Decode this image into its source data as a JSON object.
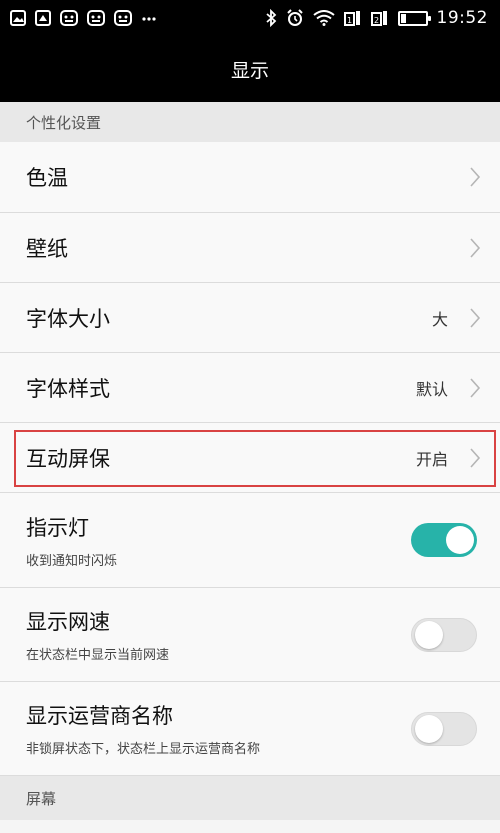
{
  "status_bar": {
    "time": "19:52",
    "battery_level": 0.22,
    "left_icons": [
      "image-icon",
      "gallery-icon",
      "message-icon",
      "message-icon",
      "message-icon",
      "more-dots-icon"
    ],
    "right_icons": [
      "bluetooth-icon",
      "alarm-icon",
      "wifi-icon",
      "sim1-signal-icon",
      "sim2-signal-icon",
      "battery-icon"
    ]
  },
  "app_bar": {
    "title": "显示"
  },
  "sections": {
    "personalization": "个性化设置",
    "screen": "屏幕"
  },
  "rows": {
    "color_temp": {
      "label": "色温"
    },
    "wallpaper": {
      "label": "壁纸"
    },
    "font_size": {
      "label": "字体大小",
      "value": "大"
    },
    "font_style": {
      "label": "字体样式",
      "value": "默认"
    },
    "screensaver": {
      "label": "互动屏保",
      "value": "开启"
    },
    "indicator": {
      "label": "指示灯",
      "sub": "收到通知时闪烁",
      "enabled": true
    },
    "net_speed": {
      "label": "显示网速",
      "sub": "在状态栏中显示当前网速",
      "enabled": false
    },
    "carrier": {
      "label": "显示运营商名称",
      "sub": "非锁屏状态下，状态栏上显示运营商名称",
      "enabled": false
    }
  },
  "colors": {
    "toggle_on": "#27b3a9",
    "highlight": "#d94343"
  }
}
